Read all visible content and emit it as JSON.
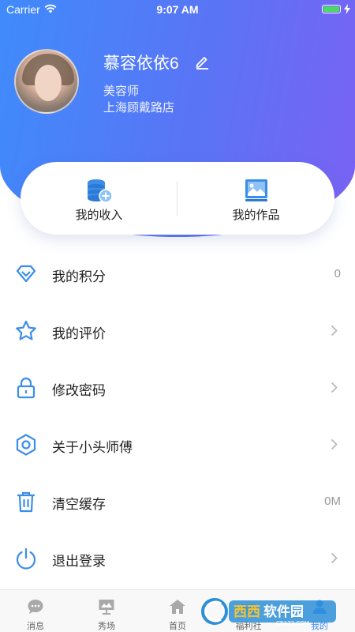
{
  "status_bar": {
    "carrier": "Carrier",
    "time": "9:07 AM"
  },
  "profile": {
    "name": "慕容依依6",
    "role": "美容师",
    "store": "上海顾戴路店"
  },
  "quick_card": {
    "items": [
      {
        "label": "我的收入",
        "icon": "coins-add-icon"
      },
      {
        "label": "我的作品",
        "icon": "image-gallery-icon"
      }
    ]
  },
  "menu": {
    "items": [
      {
        "label": "我的积分",
        "value": "0",
        "icon": "diamond-icon"
      },
      {
        "label": "我的评价",
        "value": "",
        "icon": "star-icon"
      },
      {
        "label": "修改密码",
        "value": "",
        "icon": "lock-icon"
      },
      {
        "label": "关于小头师傅",
        "value": "",
        "icon": "hexagon-nut-icon"
      },
      {
        "label": "清空缓存",
        "value": "0M",
        "icon": "trash-icon"
      },
      {
        "label": "退出登录",
        "value": "",
        "icon": "power-icon"
      }
    ]
  },
  "tabbar": {
    "items": [
      {
        "label": "消息",
        "icon": "chat-bubble-icon"
      },
      {
        "label": "秀场",
        "icon": "presentation-icon"
      },
      {
        "label": "首页",
        "icon": "home-icon"
      },
      {
        "label": "福利社",
        "icon": "gift-icon"
      },
      {
        "label": "我的",
        "icon": "person-icon"
      }
    ],
    "active": "我的"
  },
  "watermark": {
    "brand": "西西软件园",
    "domain": "CR173.COM"
  },
  "colors": {
    "accent": "#3f8bfb",
    "gradient_end": "#7a62f3",
    "icon_blue": "#3b8ee8"
  }
}
